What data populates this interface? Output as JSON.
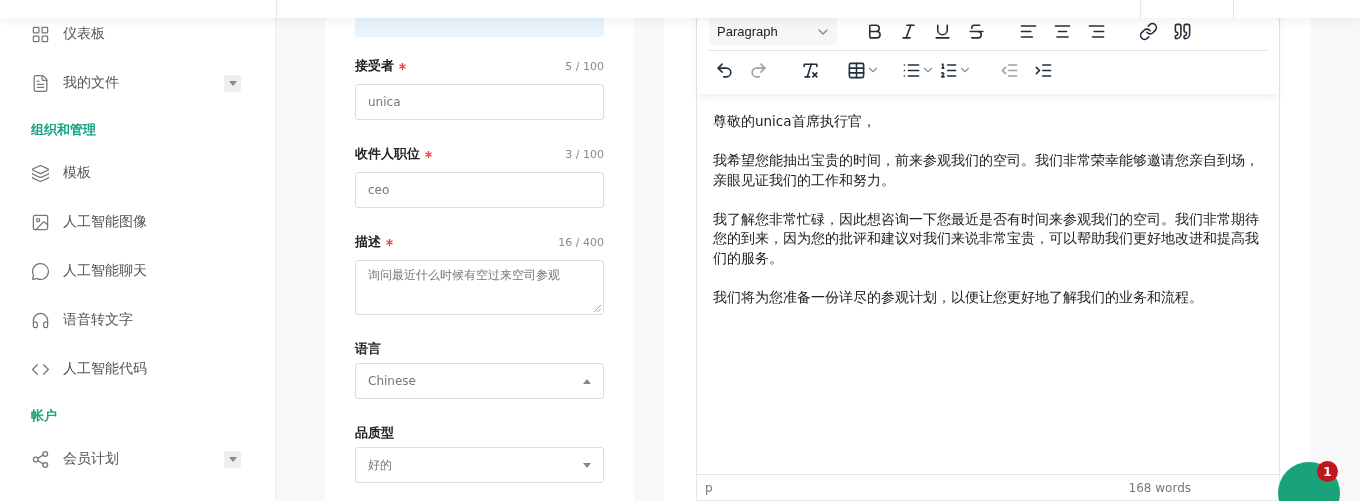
{
  "sidebar": {
    "groups": [
      {
        "items": [
          {
            "label": "仪表板",
            "expandable": false
          },
          {
            "label": "我的文件",
            "expandable": true
          }
        ]
      },
      {
        "title": "组织和管理",
        "items": [
          {
            "label": "模板",
            "expandable": false
          },
          {
            "label": "人工智能图像",
            "expandable": false
          },
          {
            "label": "人工智能聊天",
            "expandable": false
          },
          {
            "label": "语音转文字",
            "expandable": false
          },
          {
            "label": "人工智能代码",
            "expandable": false
          }
        ]
      },
      {
        "title": "帐户",
        "items": [
          {
            "label": "会员计划",
            "expandable": true
          }
        ]
      }
    ]
  },
  "form": {
    "fields": [
      {
        "kind": "input",
        "label": "接受者",
        "required": true,
        "counter": "5 / 100",
        "value": "unica"
      },
      {
        "kind": "input",
        "label": "收件人职位",
        "required": true,
        "counter": "3 / 100",
        "value": "ceo"
      },
      {
        "kind": "textarea",
        "label": "描述",
        "required": true,
        "counter": "16 / 400",
        "value": "询问最近什么时候有空过来空司参观"
      },
      {
        "kind": "select",
        "label": "语言",
        "required": false,
        "value": "Chinese",
        "open": true
      },
      {
        "kind": "select",
        "label": "品质型",
        "required": false,
        "value": "好的",
        "open": false
      }
    ]
  },
  "editor": {
    "block_format": "Paragraph",
    "toolbar_rows": [
      [
        [
          {
            "kind": "bold",
            "disabled": false
          },
          {
            "kind": "italic",
            "disabled": false
          },
          {
            "kind": "underline",
            "disabled": false
          },
          {
            "kind": "strike",
            "disabled": false
          }
        ],
        [
          {
            "kind": "align-left",
            "disabled": false
          },
          {
            "kind": "align-center",
            "disabled": false
          },
          {
            "kind": "align-right",
            "disabled": false
          }
        ],
        [
          {
            "kind": "link",
            "disabled": false
          },
          {
            "kind": "quote",
            "disabled": false
          }
        ]
      ],
      [
        [
          {
            "kind": "undo",
            "disabled": false
          },
          {
            "kind": "redo",
            "disabled": true
          }
        ],
        [
          {
            "kind": "clear-format",
            "disabled": false
          }
        ],
        [
          {
            "kind": "table",
            "disabled": false,
            "menu": true
          }
        ],
        [
          {
            "kind": "bullet-list",
            "disabled": false,
            "menu": true
          },
          {
            "kind": "number-list",
            "disabled": false,
            "menu": true
          }
        ],
        [
          {
            "kind": "outdent",
            "disabled": true
          },
          {
            "kind": "indent",
            "disabled": false
          }
        ]
      ]
    ],
    "paragraphs": [
      "尊敬的unica首席执行官，",
      "我希望您能抽出宝贵的时间，前来参观我们的空司。我们非常荣幸能够邀请您亲自到场，亲眼见证我们的工作和努力。",
      "我了解您非常忙碌，因此想咨询一下您最近是否有时间来参观我们的空司。我们非常期待您的到来，因为您的批评和建议对我们来说非常宝贵，可以帮助我们更好地改进和提高我们的服务。",
      "我们将为您准备一份详尽的参观计划，以便让您更好地了解我们的业务和流程。"
    ],
    "path": "p",
    "word_count": "168 words"
  },
  "chat_button": {
    "badge": "1"
  }
}
